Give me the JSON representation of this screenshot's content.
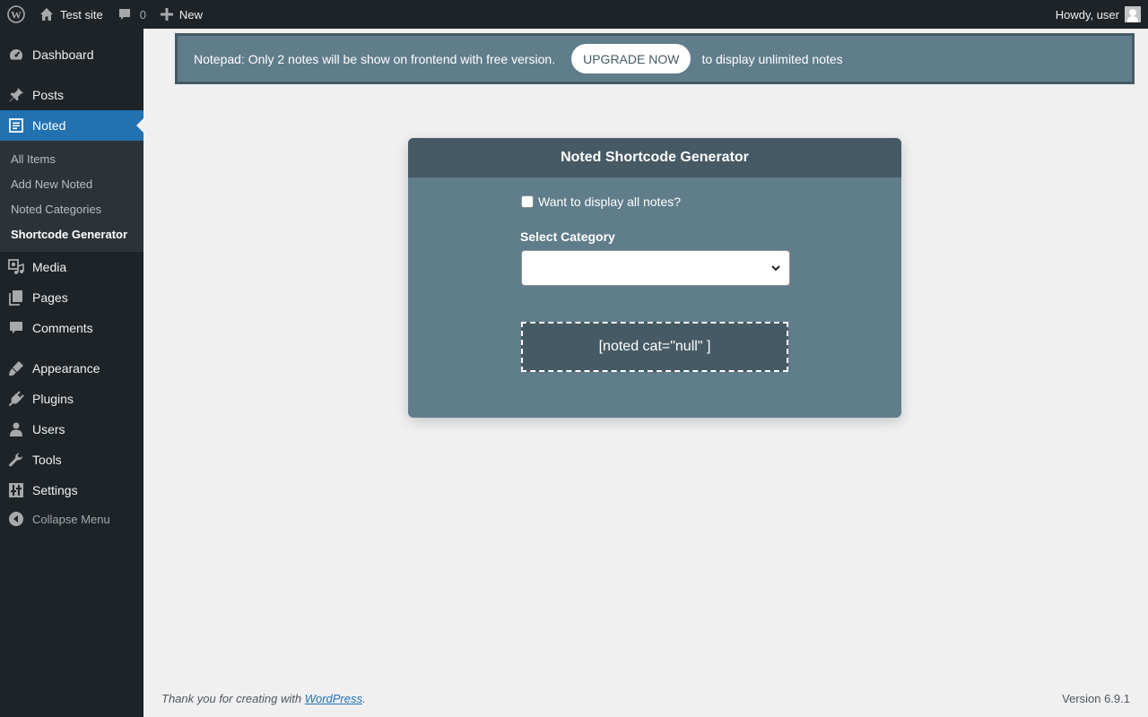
{
  "adminbar": {
    "site_name": "Test site",
    "comments_count": "0",
    "new_label": "New",
    "howdy": "Howdy, user"
  },
  "sidebar": {
    "items": [
      {
        "label": "Dashboard",
        "icon": "dashboard-icon"
      },
      {
        "label": "Posts",
        "icon": "pin-icon"
      },
      {
        "label": "Noted",
        "icon": "note-icon",
        "active": true
      },
      {
        "label": "Media",
        "icon": "media-icon"
      },
      {
        "label": "Pages",
        "icon": "pages-icon"
      },
      {
        "label": "Comments",
        "icon": "comment-icon"
      },
      {
        "label": "Appearance",
        "icon": "brush-icon"
      },
      {
        "label": "Plugins",
        "icon": "plug-icon"
      },
      {
        "label": "Users",
        "icon": "user-icon"
      },
      {
        "label": "Tools",
        "icon": "wrench-icon"
      },
      {
        "label": "Settings",
        "icon": "settings-icon"
      }
    ],
    "submenu": [
      {
        "label": "All Items"
      },
      {
        "label": "Add New Noted"
      },
      {
        "label": "Noted Categories"
      },
      {
        "label": "Shortcode Generator",
        "current": true
      }
    ],
    "collapse_label": "Collapse Menu"
  },
  "notice": {
    "text_before": "Notepad: Only 2 notes will be show on frontend with free version.",
    "button_label": "UPGRADE NOW",
    "text_after": "to display unlimited notes"
  },
  "generator": {
    "title": "Noted Shortcode Generator",
    "checkbox_label": "Want to display all notes?",
    "category_label": "Select Category",
    "category_value": "",
    "shortcode": "[noted cat=\"null\" ]"
  },
  "footer": {
    "thanks_prefix": "Thank you for creating with ",
    "thanks_link": "WordPress",
    "thanks_suffix": ".",
    "version": "Version 6.9.1"
  },
  "colors": {
    "admin_bg": "#1d2327",
    "accent": "#2271b1",
    "card_bg": "#607d8b",
    "card_header": "#455a64"
  }
}
